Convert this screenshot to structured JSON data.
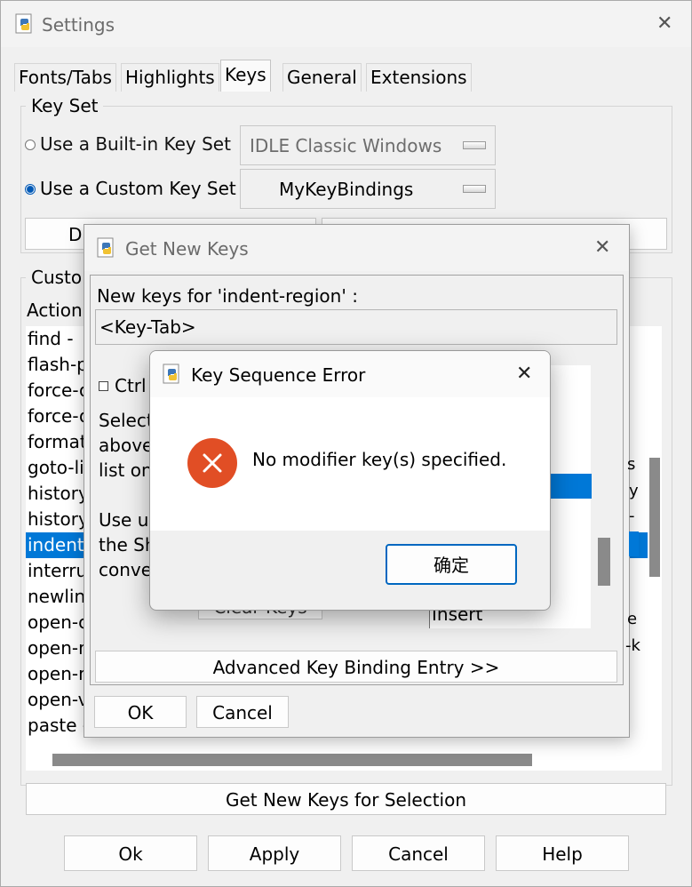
{
  "settings": {
    "title": "Settings",
    "close_glyph": "✕",
    "tabs": [
      {
        "label": "Fonts/Tabs"
      },
      {
        "label": "Highlights"
      },
      {
        "label": "Keys"
      },
      {
        "label": "General"
      },
      {
        "label": "Extensions"
      }
    ],
    "active_tab": "Keys",
    "key_set": {
      "group_label": "Key Set",
      "builtin_label": "Use a Built-in Key Set",
      "builtin_value": "IDLE Classic Windows",
      "custom_label": "Use a Custom Key Set",
      "custom_value": "MyKeyBindings",
      "selected": "custom",
      "button_left_partial": "D"
    },
    "custom_group_label_partial": "Custo",
    "actions_header_partial": "Action",
    "actions": [
      "find - ",
      "flash-p",
      "force-o",
      "force-o",
      "format",
      "goto-li",
      "history",
      "history",
      "indent",
      "interru",
      "newlin",
      "open-c",
      "open-n",
      "open-n",
      "open-v",
      "paste -"
    ],
    "selected_action_index": 8,
    "get_new_keys_button": "Get New Keys for Selection",
    "footer_buttons": {
      "ok": "Ok",
      "apply": "Apply",
      "cancel": "Cancel",
      "help": "Help"
    }
  },
  "get_new_keys": {
    "title": "Get New Keys",
    "close_glyph": "✕",
    "prompt": "New keys for 'indent-region' :",
    "keys_value": "<Key-Tab>",
    "ctrl_label": "Ctrl",
    "help_text_partial": [
      "Select",
      "above",
      "list on",
      "",
      "Use u",
      "the Sh",
      "conve"
    ],
    "right_peek_chars": [
      "s",
      "y",
      "-",
      "e",
      "-k"
    ],
    "key_list_visible_item": "Insert",
    "clear_keys_partial": "Clear Keys",
    "advanced_button": "Advanced Key Binding Entry >>",
    "ok_button": "OK",
    "cancel_button": "Cancel"
  },
  "error_dialog": {
    "title": "Key Sequence Error",
    "close_glyph": "✕",
    "message": "No modifier key(s) specified.",
    "ok_button": "确定",
    "icon": "error-icon"
  },
  "colors": {
    "selection": "#0078d7",
    "error_icon": "#e14e25",
    "radio_selected": "#0058b5"
  }
}
